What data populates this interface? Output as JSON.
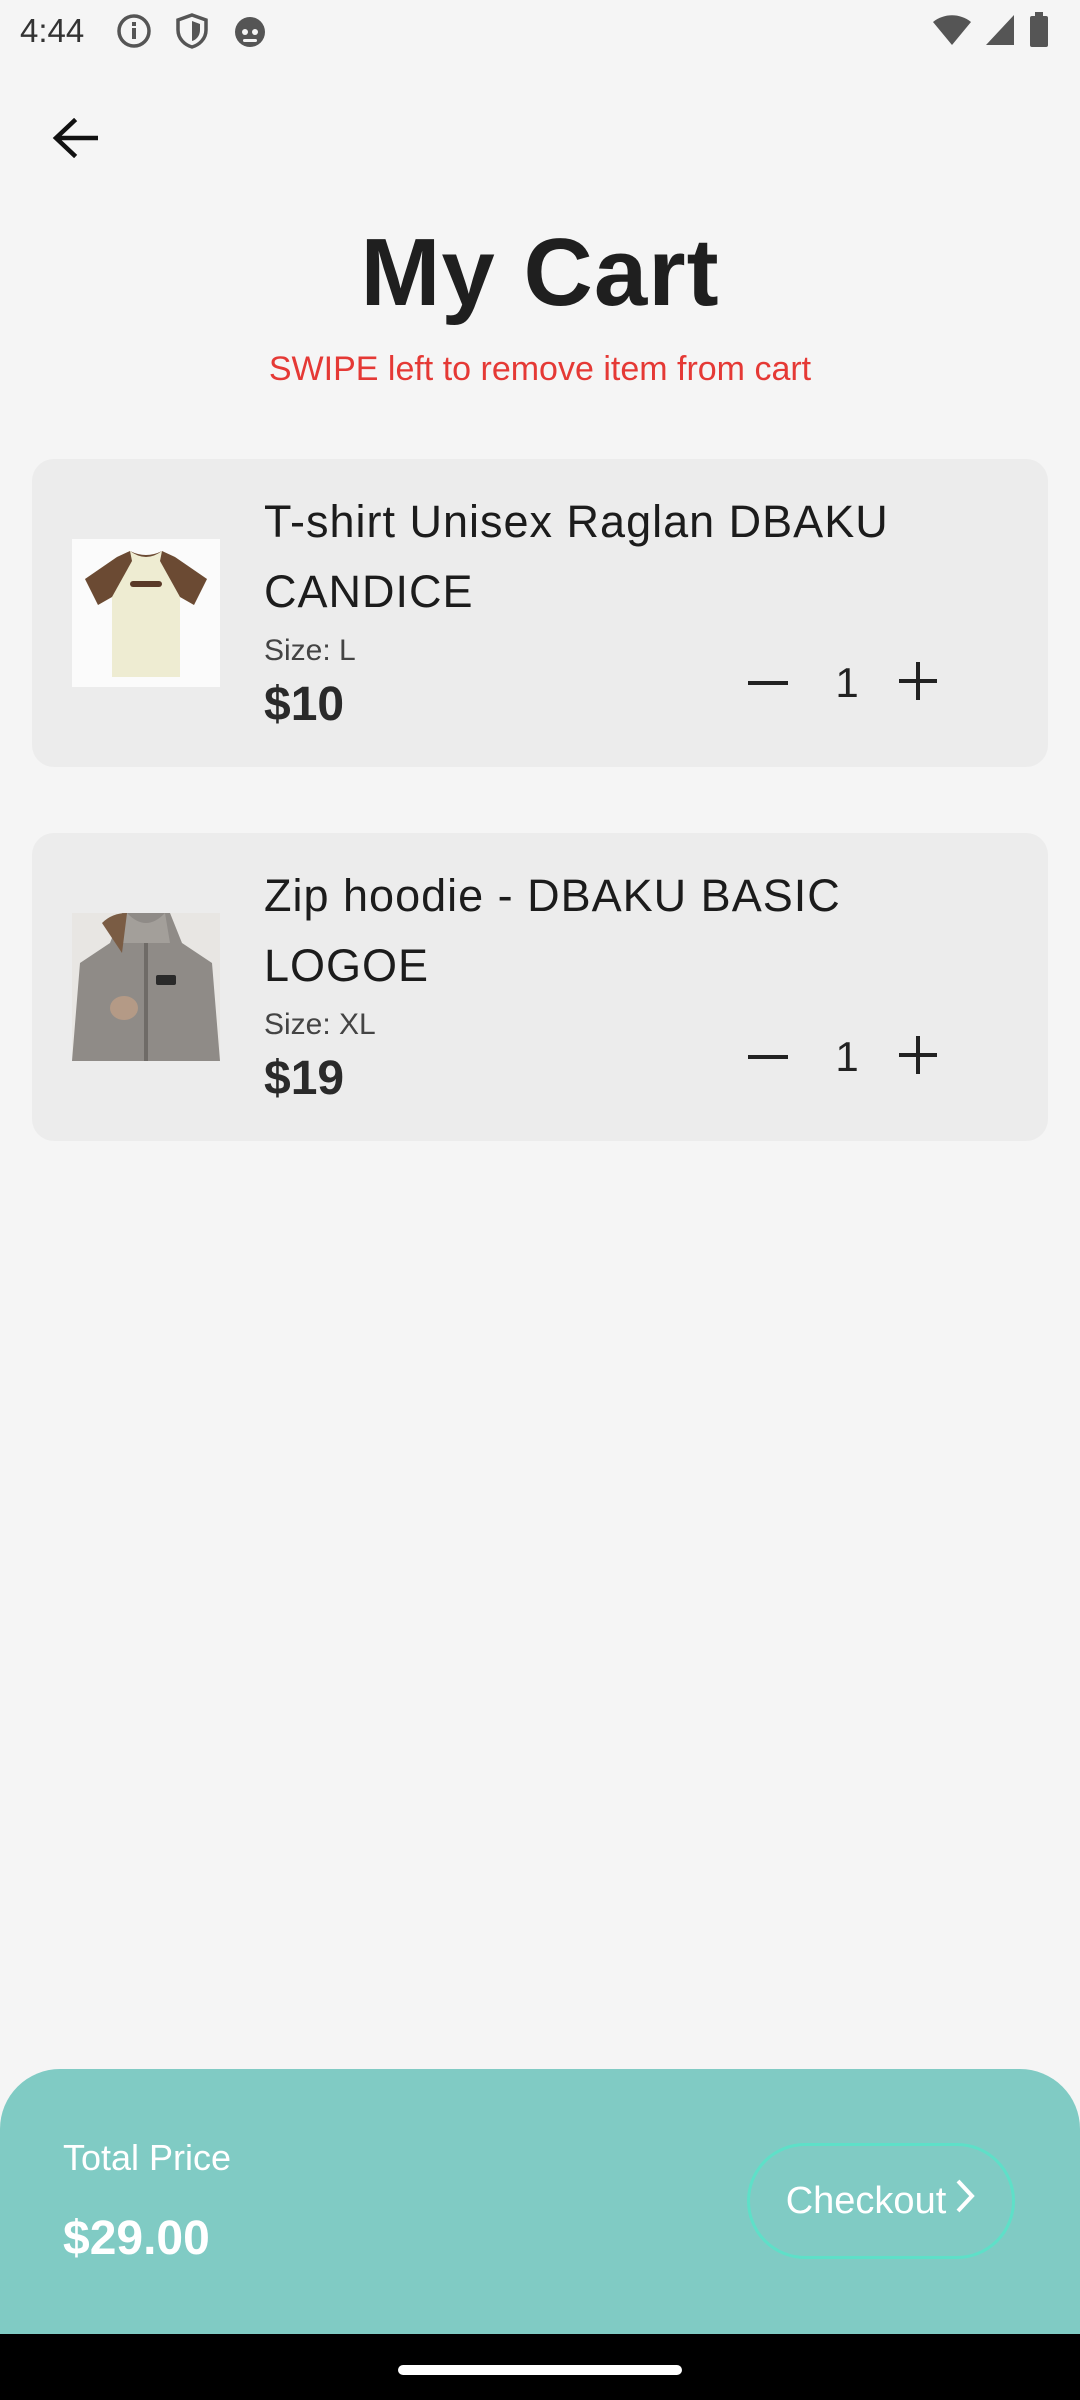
{
  "status_bar": {
    "time": "4:44",
    "left_icons": [
      "info-icon",
      "shield-icon",
      "cat-icon"
    ],
    "right_icons": [
      "wifi-icon",
      "signal-icon",
      "battery-icon"
    ]
  },
  "header": {
    "back_icon": "arrow-left-icon",
    "title": "My Cart",
    "hint": "SWIPE left to remove item from cart",
    "hint_color": "#e53935"
  },
  "cart": {
    "items": [
      {
        "name": "T-shirt Unisex Raglan DBAKU CANDICE",
        "size_label": "Size: L",
        "price": "$10",
        "quantity": "1",
        "image": "tshirt-image"
      },
      {
        "name": "Zip hoodie - DBAKU BASIC LOGOE",
        "size_label": "Size: XL",
        "price": "$19",
        "quantity": "1",
        "image": "hoodie-image"
      }
    ]
  },
  "footer": {
    "total_label": "Total Price",
    "total_value": "$29.00",
    "checkout_label": "Checkout",
    "accent_color": "#80cbc4"
  }
}
